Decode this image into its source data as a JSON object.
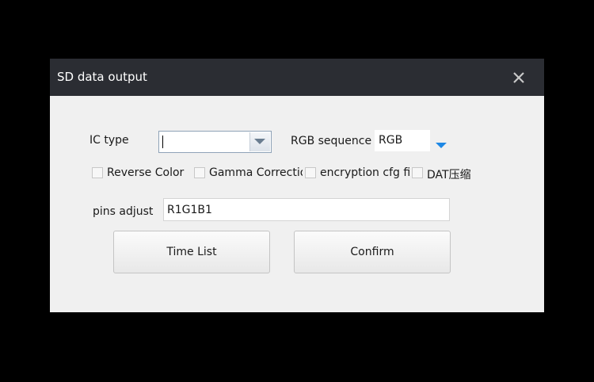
{
  "window": {
    "title": "SD data output",
    "close_icon": "close-icon"
  },
  "form": {
    "ic_type_label": "IC type",
    "ic_type_value": "",
    "rgb_sequence_label": "RGB sequence",
    "rgb_sequence_value": "RGB",
    "checkboxes": [
      {
        "label": "Reverse Color",
        "checked": false
      },
      {
        "label": "Gamma Correction",
        "checked": false
      },
      {
        "label": "encryption cfg file",
        "checked": false
      },
      {
        "label": "DAT压缩",
        "checked": false
      }
    ],
    "pins_adjust_label": "pins adjust",
    "pins_adjust_value": "R1G1B1"
  },
  "buttons": {
    "time_list": "Time List",
    "confirm": "Confirm"
  },
  "colors": {
    "titlebar": "#2b2d33",
    "dialog_bg": "#f0f0f0",
    "accent_arrow": "#1e88e5"
  }
}
